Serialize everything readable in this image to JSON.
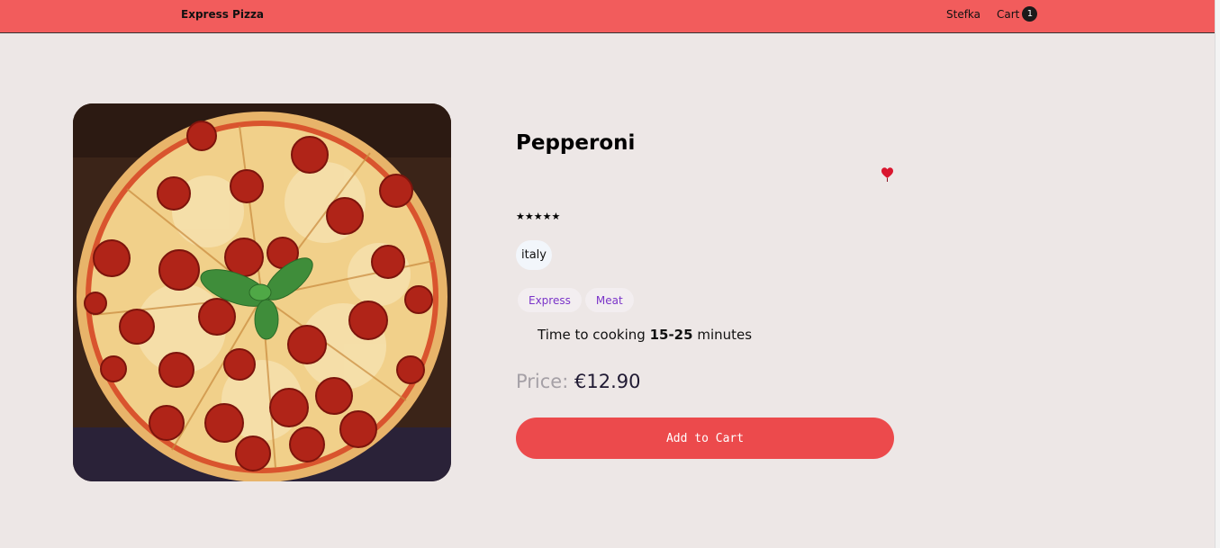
{
  "header": {
    "brand": "Express Pizza",
    "user": "Stefka",
    "cart_label": "Cart",
    "cart_count": "1"
  },
  "product": {
    "title": "Pepperoni",
    "rating_stars": "★★★★★",
    "origin": "italy",
    "tags": [
      "Express",
      "Meat"
    ],
    "cook_prefix": "Time to cooking",
    "cook_time": "15-25",
    "cook_suffix": "minutes",
    "price_label": "Price:",
    "price_value": "€12.90",
    "add_button": "Add to Cart"
  },
  "colors": {
    "header_bg": "#f25c5c",
    "page_bg": "#ede7e6",
    "button_bg": "#ec4a4c",
    "tag_text": "#7b35c9",
    "heart": "#d9162e"
  },
  "icons": {
    "favorite": "heart-icon"
  }
}
